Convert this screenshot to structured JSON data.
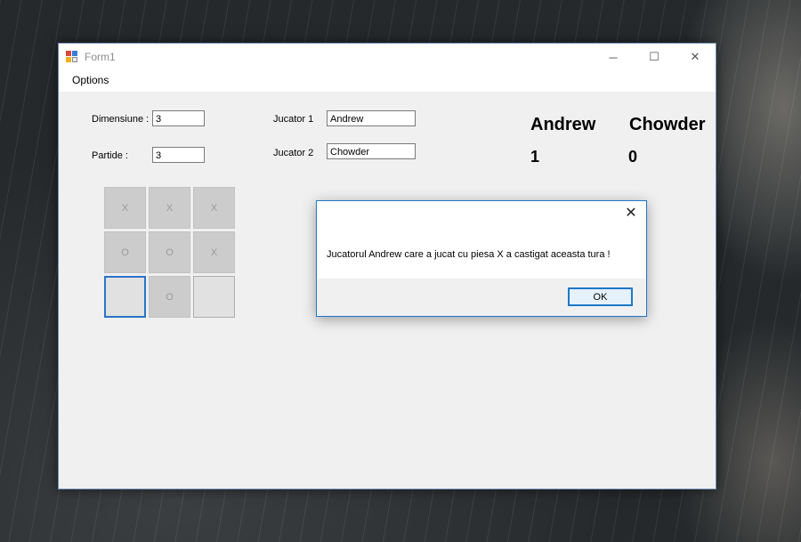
{
  "window": {
    "title": "Form1",
    "controls": {
      "minimize": "─",
      "maximize": "☐",
      "close": "✕"
    }
  },
  "menu": {
    "options": "Options"
  },
  "settings": {
    "dimension_label": "Dimensiune :",
    "dimension_value": "3",
    "rounds_label": "Partide :",
    "rounds_value": "3",
    "player1_label": "Jucator 1",
    "player1_value": "Andrew",
    "player2_label": "Jucator 2",
    "player2_value": "Chowder"
  },
  "scoreboard": {
    "player1_name": "Andrew",
    "player2_name": "Chowder",
    "player1_score": "1",
    "player2_score": "0"
  },
  "board": {
    "cells": [
      "X",
      "X",
      "X",
      "O",
      "O",
      "X",
      "",
      "O",
      ""
    ]
  },
  "dialog": {
    "close": "✕",
    "message": "Jucatorul Andrew care a jucat cu piesa X a castigat aceasta tura !",
    "ok_label": "OK"
  },
  "colors": {
    "accent": "#1c78c8",
    "cell_disabled": "#cccccc",
    "cell_empty": "#e1e1e1"
  }
}
